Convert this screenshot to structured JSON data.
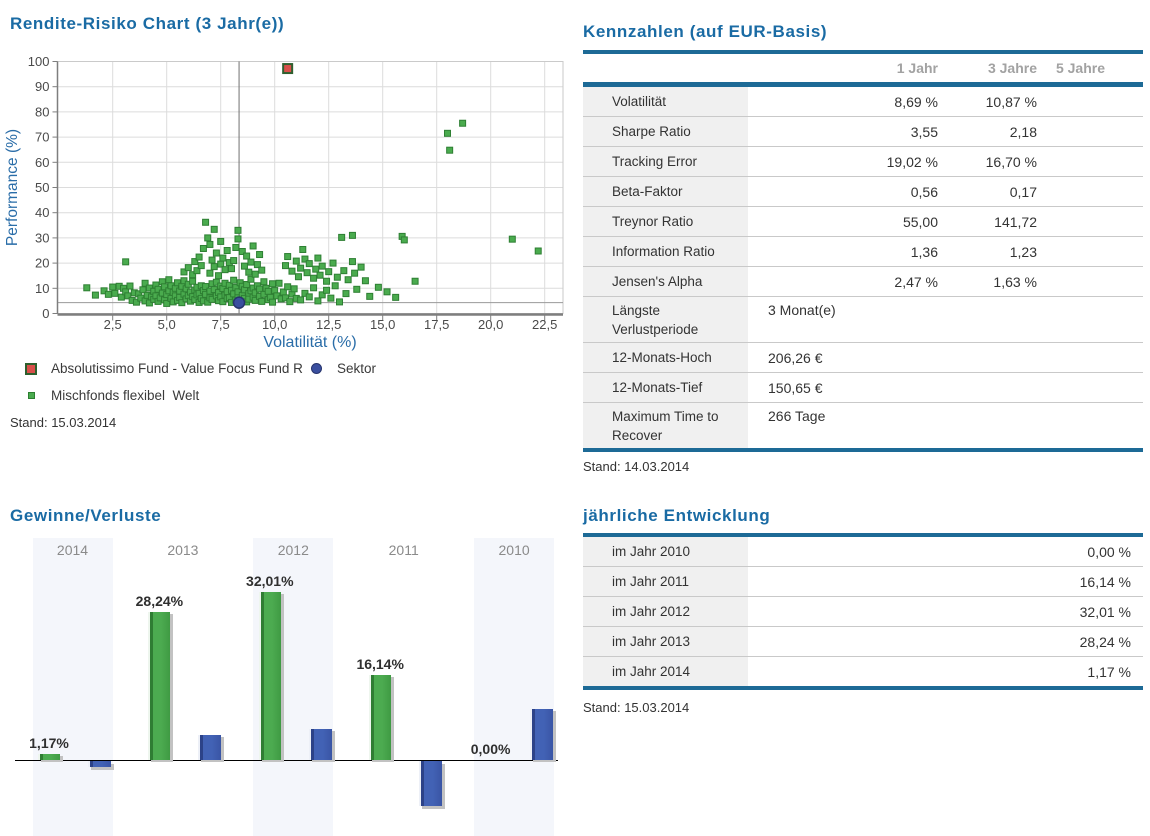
{
  "colors": {
    "title_blue": "#1a6ba4",
    "bar_blue_rule": "#1d6a96",
    "fund_red": "#d94f4a",
    "fund_border_green": "#2d5f2d",
    "peer_green": "#4aab4e",
    "sektor_blue": "#3a4f9f",
    "stripe_bg": "#f4f6fb"
  },
  "chart_data": [
    {
      "type": "scatter",
      "title": "Rendite-Risiko Chart (3 Jahr(e))",
      "xlabel": "Volatilität (%)",
      "ylabel": "Performance (%)",
      "xlim": [
        0,
        23.4
      ],
      "ylim": [
        0,
        100
      ],
      "xticks": [
        2.5,
        5.0,
        7.5,
        10.0,
        12.5,
        15.0,
        17.5,
        20.0,
        22.5
      ],
      "xtick_labels": [
        "2,5",
        "5,0",
        "7,5",
        "10,0",
        "12,5",
        "15,0",
        "17,5",
        "20,0",
        "22,5"
      ],
      "yticks": [
        0,
        10,
        20,
        30,
        40,
        50,
        60,
        70,
        80,
        90,
        100
      ],
      "ytick_labels": [
        "0",
        "10",
        "20",
        "30",
        "40",
        "50",
        "60",
        "70",
        "80",
        "90",
        "100"
      ],
      "grid": true,
      "crosshair": {
        "x": 8.35,
        "y": 4.3
      },
      "stand": "Stand: 15.03.2014",
      "series": [
        {
          "name": "Absolutissimo Fund - Value Focus Fund R",
          "marker": "red-square",
          "points": [
            [
              10.6,
              97.2
            ]
          ]
        },
        {
          "name": "Sektor",
          "marker": "blue-circle",
          "points": [
            [
              8.35,
              4.3
            ]
          ]
        },
        {
          "name": "Mischfonds flexibel  Welt",
          "marker": "green-square",
          "points": [
            [
              1.3,
              10.2
            ],
            [
              1.7,
              7.3
            ],
            [
              2.1,
              9.0
            ],
            [
              2.3,
              7.6
            ],
            [
              2.5,
              10.5
            ],
            [
              2.6,
              8.0
            ],
            [
              2.8,
              10.8
            ],
            [
              2.9,
              6.5
            ],
            [
              3.0,
              10.0
            ],
            [
              3.1,
              8.6
            ],
            [
              3.2,
              7.0
            ],
            [
              3.3,
              10.9
            ],
            [
              3.1,
              20.5
            ],
            [
              3.4,
              5.2
            ],
            [
              3.5,
              8.2
            ],
            [
              3.6,
              4.5
            ],
            [
              3.7,
              7.8
            ],
            [
              3.8,
              6.1
            ],
            [
              3.9,
              9.4
            ],
            [
              4.0,
              5.0
            ],
            [
              4.0,
              12.0
            ],
            [
              4.1,
              7.2
            ],
            [
              4.2,
              4.2
            ],
            [
              4.2,
              10.1
            ],
            [
              4.3,
              6.6
            ],
            [
              4.4,
              8.8
            ],
            [
              4.4,
              5.6
            ],
            [
              4.5,
              11.3
            ],
            [
              4.5,
              7.0
            ],
            [
              4.6,
              4.8
            ],
            [
              4.6,
              9.6
            ],
            [
              4.7,
              6.2
            ],
            [
              4.8,
              12.6
            ],
            [
              4.8,
              8.1
            ],
            [
              4.9,
              5.4
            ],
            [
              4.9,
              10.6
            ],
            [
              5.0,
              7.5
            ],
            [
              5.0,
              4.0
            ],
            [
              5.1,
              9.0
            ],
            [
              5.1,
              13.4
            ],
            [
              5.2,
              6.0
            ],
            [
              5.2,
              11.0
            ],
            [
              5.3,
              8.4
            ],
            [
              5.3,
              4.6
            ],
            [
              5.4,
              10.0
            ],
            [
              5.4,
              7.0
            ],
            [
              5.5,
              5.2
            ],
            [
              5.5,
              12.2
            ],
            [
              5.6,
              8.9
            ],
            [
              5.6,
              6.4
            ],
            [
              5.7,
              10.8
            ],
            [
              5.7,
              4.3
            ],
            [
              5.8,
              7.7
            ],
            [
              5.8,
              13.0
            ],
            [
              5.9,
              5.8
            ],
            [
              5.9,
              9.8
            ],
            [
              6.0,
              7.1
            ],
            [
              6.0,
              11.6
            ],
            [
              6.1,
              4.9
            ],
            [
              6.1,
              8.5
            ],
            [
              6.2,
              6.7
            ],
            [
              6.2,
              12.8
            ],
            [
              6.3,
              9.3
            ],
            [
              6.3,
              5.5
            ],
            [
              6.4,
              10.4
            ],
            [
              6.4,
              7.4
            ],
            [
              6.5,
              4.4
            ],
            [
              6.5,
              8.0
            ],
            [
              6.6,
              11.0
            ],
            [
              6.6,
              6.0
            ],
            [
              6.7,
              9.1
            ],
            [
              5.8,
              16.5
            ],
            [
              6.0,
              18.2
            ],
            [
              6.2,
              15.4
            ],
            [
              6.3,
              20.6
            ],
            [
              6.4,
              17.0
            ],
            [
              6.5,
              22.4
            ],
            [
              6.6,
              19.0
            ],
            [
              6.7,
              25.8
            ],
            [
              6.8,
              36.2
            ],
            [
              6.9,
              30.0
            ],
            [
              7.0,
              27.4
            ],
            [
              7.0,
              16.0
            ],
            [
              7.1,
              21.2
            ],
            [
              7.2,
              33.4
            ],
            [
              7.2,
              18.6
            ],
            [
              7.3,
              24.0
            ],
            [
              7.4,
              15.0
            ],
            [
              7.5,
              19.6
            ],
            [
              7.5,
              28.6
            ],
            [
              7.6,
              22.0
            ],
            [
              7.7,
              17.4
            ],
            [
              7.8,
              25.0
            ],
            [
              7.9,
              20.2
            ],
            [
              6.7,
              5.0
            ],
            [
              6.8,
              7.6
            ],
            [
              6.8,
              10.7
            ],
            [
              6.9,
              4.5
            ],
            [
              7.0,
              8.9
            ],
            [
              7.0,
              6.2
            ],
            [
              7.1,
              11.8
            ],
            [
              7.1,
              5.6
            ],
            [
              7.2,
              9.5
            ],
            [
              7.3,
              7.0
            ],
            [
              7.3,
              12.4
            ],
            [
              7.4,
              5.1
            ],
            [
              7.4,
              8.3
            ],
            [
              7.5,
              10.9
            ],
            [
              7.5,
              6.6
            ],
            [
              7.6,
              4.7
            ],
            [
              7.6,
              9.9
            ],
            [
              7.7,
              7.3
            ],
            [
              7.7,
              12.0
            ],
            [
              7.8,
              5.9
            ],
            [
              7.8,
              8.7
            ],
            [
              7.9,
              11.2
            ],
            [
              7.9,
              6.3
            ],
            [
              8.0,
              4.4
            ],
            [
              8.0,
              9.2
            ],
            [
              8.1,
              7.8
            ],
            [
              8.1,
              13.2
            ],
            [
              8.2,
              5.3
            ],
            [
              8.2,
              10.3
            ],
            [
              8.3,
              6.9
            ],
            [
              8.3,
              8.6
            ],
            [
              8.4,
              12.2
            ],
            [
              8.4,
              4.9
            ],
            [
              8.5,
              7.2
            ],
            [
              8.5,
              10.8
            ],
            [
              8.6,
              6.0
            ],
            [
              8.6,
              9.4
            ],
            [
              8.7,
              4.6
            ],
            [
              8.7,
              11.5
            ],
            [
              8.8,
              7.9
            ],
            [
              8.8,
              5.7
            ],
            [
              8.9,
              9.0
            ],
            [
              8.9,
              13.6
            ],
            [
              9.0,
              6.5
            ],
            [
              9.0,
              10.1
            ],
            [
              8.0,
              17.8
            ],
            [
              8.1,
              21.0
            ],
            [
              8.2,
              26.2
            ],
            [
              8.3,
              33.0
            ],
            [
              8.3,
              29.6
            ],
            [
              8.5,
              24.6
            ],
            [
              8.6,
              18.8
            ],
            [
              8.7,
              22.8
            ],
            [
              8.8,
              16.4
            ],
            [
              8.9,
              20.4
            ],
            [
              9.0,
              26.8
            ],
            [
              9.1,
              15.6
            ],
            [
              9.2,
              19.4
            ],
            [
              9.3,
              23.4
            ],
            [
              9.4,
              17.2
            ],
            [
              9.1,
              8.2
            ],
            [
              9.1,
              5.2
            ],
            [
              9.2,
              11.0
            ],
            [
              9.3,
              6.8
            ],
            [
              9.3,
              9.7
            ],
            [
              9.4,
              4.8
            ],
            [
              9.5,
              12.6
            ],
            [
              9.5,
              7.6
            ],
            [
              9.6,
              10.0
            ],
            [
              9.7,
              5.5
            ],
            [
              9.7,
              8.8
            ],
            [
              9.8,
              6.4
            ],
            [
              9.9,
              11.8
            ],
            [
              9.9,
              4.5
            ],
            [
              10.0,
              9.1
            ],
            [
              10.1,
              7.0
            ],
            [
              10.2,
              12.0
            ],
            [
              10.3,
              5.8
            ],
            [
              10.4,
              8.5
            ],
            [
              10.5,
              6.2
            ],
            [
              10.6,
              10.6
            ],
            [
              10.7,
              4.7
            ],
            [
              10.8,
              7.7
            ],
            [
              10.9,
              9.8
            ],
            [
              11.0,
              6.0
            ],
            [
              10.5,
              19.0
            ],
            [
              10.6,
              22.6
            ],
            [
              10.8,
              16.8
            ],
            [
              11.0,
              20.8
            ],
            [
              11.1,
              14.6
            ],
            [
              11.2,
              18.0
            ],
            [
              11.3,
              25.4
            ],
            [
              11.4,
              21.6
            ],
            [
              11.5,
              16.2
            ],
            [
              11.6,
              19.8
            ],
            [
              11.8,
              14.0
            ],
            [
              11.9,
              17.6
            ],
            [
              12.0,
              22.0
            ],
            [
              12.1,
              15.2
            ],
            [
              12.2,
              18.8
            ],
            [
              12.4,
              12.8
            ],
            [
              12.5,
              16.6
            ],
            [
              12.7,
              20.0
            ],
            [
              12.9,
              14.4
            ],
            [
              13.1,
              30.2
            ],
            [
              13.2,
              17.0
            ],
            [
              13.4,
              13.4
            ],
            [
              13.6,
              31.0
            ],
            [
              13.6,
              20.6
            ],
            [
              13.7,
              16.0
            ],
            [
              14.0,
              18.4
            ],
            [
              14.2,
              13.0
            ],
            [
              11.2,
              5.4
            ],
            [
              11.4,
              8.0
            ],
            [
              11.6,
              6.6
            ],
            [
              11.8,
              10.2
            ],
            [
              12.0,
              5.0
            ],
            [
              12.2,
              7.4
            ],
            [
              12.4,
              9.2
            ],
            [
              12.6,
              6.1
            ],
            [
              12.8,
              11.0
            ],
            [
              13.0,
              4.6
            ],
            [
              13.3,
              7.9
            ],
            [
              13.8,
              9.6
            ],
            [
              14.4,
              6.8
            ],
            [
              14.8,
              10.4
            ],
            [
              15.2,
              8.6
            ],
            [
              15.6,
              6.4
            ],
            [
              15.9,
              30.6
            ],
            [
              16.0,
              29.2
            ],
            [
              16.5,
              12.8
            ],
            [
              18.0,
              71.5
            ],
            [
              18.1,
              64.8
            ],
            [
              18.7,
              75.5
            ],
            [
              21.0,
              29.5
            ],
            [
              22.2,
              24.8
            ]
          ]
        }
      ]
    },
    {
      "type": "bar",
      "title": "Gewinne/Verluste",
      "categories": [
        "2014",
        "2013",
        "2012",
        "2011",
        "2010"
      ],
      "series": [
        {
          "color": "#3f9a43",
          "values": [
            1.17,
            28.24,
            32.01,
            16.14,
            0.0
          ],
          "labels": [
            "1,17%",
            "28,24%",
            "32,01%",
            "16,14%",
            "0,00%"
          ]
        },
        {
          "color": "#3a55a5",
          "values": [
            -1.1,
            4.8,
            5.9,
            -8.6,
            9.7
          ]
        }
      ]
    }
  ],
  "kennzahlen": {
    "title": "Kennzahlen (auf EUR-Basis)",
    "col_headers": [
      "1 Jahr",
      "3 Jahre",
      "5 Jahre"
    ],
    "rows": [
      {
        "label": "Volatilität",
        "c1": "8,69 %",
        "c2": "10,87 %",
        "c3": ""
      },
      {
        "label": "Sharpe Ratio",
        "c1": "3,55",
        "c2": "2,18",
        "c3": ""
      },
      {
        "label": "Tracking Error",
        "c1": "19,02 %",
        "c2": "16,70 %",
        "c3": ""
      },
      {
        "label": "Beta-Faktor",
        "c1": "0,56",
        "c2": "0,17",
        "c3": ""
      },
      {
        "label": "Treynor Ratio",
        "c1": "55,00",
        "c2": "141,72",
        "c3": ""
      },
      {
        "label": "Information Ratio",
        "c1": "1,36",
        "c2": "1,23",
        "c3": ""
      },
      {
        "label": "Jensen's Alpha",
        "c1": "2,47 %",
        "c2": "1,63 %",
        "c3": ""
      }
    ],
    "info_rows": [
      {
        "label": "Längste Verlustperiode",
        "value": "3 Monat(e)",
        "twoline": true
      },
      {
        "label": "12-Monats-Hoch",
        "value": "206,26 €"
      },
      {
        "label": "12-Monats-Tief",
        "value": "150,65 €"
      },
      {
        "label": "Maximum Time to Recover",
        "value": "266 Tage",
        "twoline": true
      }
    ],
    "stand": "Stand: 14.03.2014"
  },
  "entwicklung": {
    "title": "jährliche Entwicklung",
    "rows": [
      {
        "label": "im Jahr 2010",
        "value": "0,00 %"
      },
      {
        "label": "im Jahr 2011",
        "value": "16,14 %"
      },
      {
        "label": "im Jahr 2012",
        "value": "32,01 %"
      },
      {
        "label": "im Jahr 2013",
        "value": "28,24 %"
      },
      {
        "label": "im Jahr 2014",
        "value": "1,17 %"
      }
    ],
    "stand": "Stand: 15.03.2014"
  }
}
